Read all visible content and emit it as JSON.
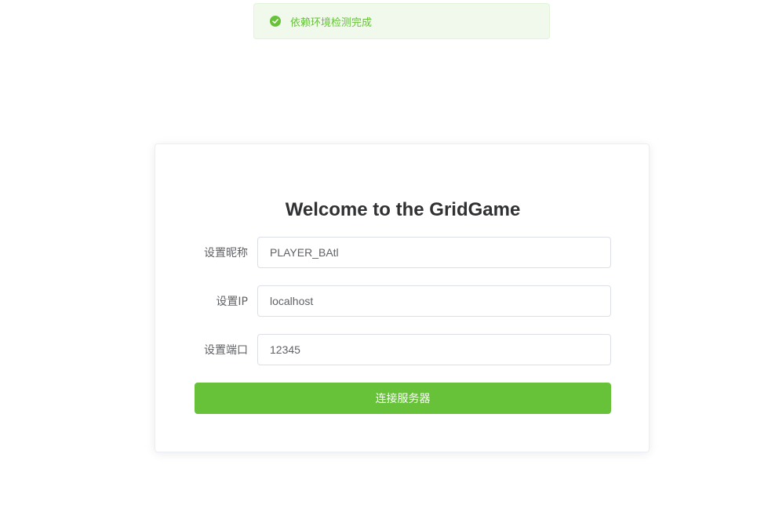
{
  "toast": {
    "message": "依赖环境检测完成",
    "icon": "check-circle-icon",
    "color": "#67c23a"
  },
  "card": {
    "title": "Welcome to the GridGame",
    "fields": [
      {
        "label": "设置昵称",
        "value": "PLAYER_BAtl"
      },
      {
        "label": "设置IP",
        "value": "localhost"
      },
      {
        "label": "设置端口",
        "value": "12345"
      }
    ],
    "connect_label": "连接服务器",
    "button_color": "#67c23a"
  }
}
